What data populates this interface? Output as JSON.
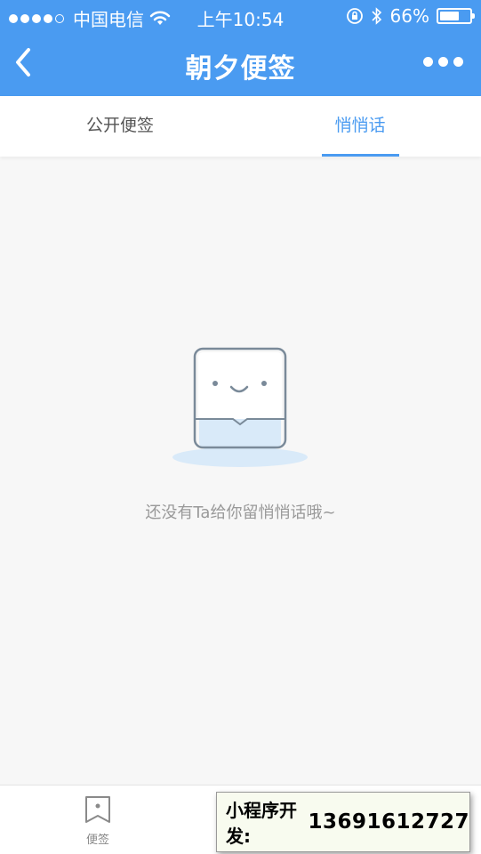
{
  "status_bar": {
    "carrier": "中国电信",
    "time": "上午10:54",
    "battery_percent": "66%",
    "battery_level": 0.66
  },
  "nav": {
    "title": "朝夕便签"
  },
  "tabs": [
    {
      "label": "公开便签",
      "active": false
    },
    {
      "label": "悄悄话",
      "active": true
    }
  ],
  "empty_state": {
    "message": "还没有Ta给你留悄悄话哦~"
  },
  "bottom_nav": {
    "items": [
      {
        "label": "便签",
        "icon": "bookmark-icon"
      }
    ]
  },
  "dev_badge": {
    "label": "小程序开发:",
    "phone": "13691612727"
  },
  "colors": {
    "primary": "#4a9bf1",
    "background": "#f7f7f7"
  }
}
